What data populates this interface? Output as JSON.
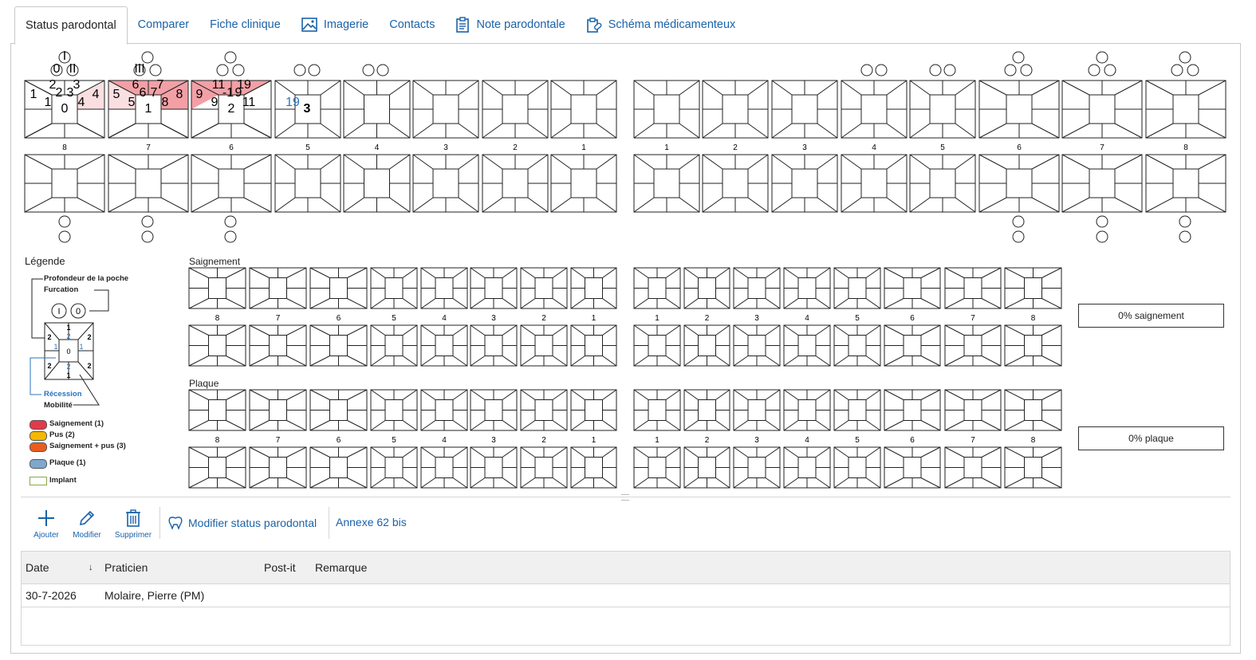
{
  "tabs": [
    {
      "label": "Status parodontal",
      "icon": "",
      "active": true
    },
    {
      "label": "Comparer",
      "icon": ""
    },
    {
      "label": "Fiche clinique",
      "icon": ""
    },
    {
      "label": "Imagerie",
      "icon": "image-icon"
    },
    {
      "label": "Contacts",
      "icon": ""
    },
    {
      "label": "Note parodontale",
      "icon": "clipboard-icon"
    },
    {
      "label": "Schéma médicamenteux",
      "icon": "medication-icon"
    }
  ],
  "chart": {
    "upper_teeth_left": [
      "8",
      "7",
      "6",
      "5",
      "4",
      "3",
      "2",
      "1"
    ],
    "upper_teeth_right": [
      "1",
      "2",
      "3",
      "4",
      "5",
      "6",
      "7",
      "8"
    ],
    "tooth8": {
      "top_l": "2",
      "top_r": "3",
      "mid_l": "1",
      "mid_r": "4",
      "blue1": "1",
      "blue2": "2",
      "blue3": "3",
      "blue4": "4",
      "center": "0",
      "furc_top": "I",
      "furc_l": "0",
      "furc_r": "II"
    },
    "tooth7": {
      "top_l": "6",
      "top_r": "7",
      "mid_l": "5",
      "mid_r": "8",
      "blue1": "5",
      "blue2": "6",
      "blue3": "7",
      "blue4": "8",
      "center": "1",
      "furc_l": "III"
    },
    "tooth6": {
      "top_l": "11",
      "top_r": "19",
      "mid_l": "9",
      "mid_r": "9",
      "blue1": "9",
      "blue2": "-1",
      "blue3": "9",
      "blue4": "11",
      "center": "2"
    },
    "tooth5": {
      "blue1": "19",
      "center": "3"
    }
  },
  "legend": {
    "title": "Légende",
    "pocket_depth": "Profondeur de la poche",
    "furcation": "Furcation",
    "recession": "Récession",
    "mobility": "Mobilité",
    "furc_l": "I",
    "furc_r": "0",
    "diagram": {
      "t1": "1",
      "t2": "2",
      "l1": "2",
      "l2": "1",
      "r1": "2",
      "r2": "1",
      "b1": "2",
      "b2": "1",
      "bl": "2",
      "br": "2",
      "center": "0"
    },
    "items": [
      {
        "label": "Saignement (1)",
        "color": "#e23a4a"
      },
      {
        "label": "Pus (2)",
        "color": "#f5b800"
      },
      {
        "label": "Saignement + pus (3)",
        "color": "#ea5d1e"
      },
      {
        "label": "Plaque (1)",
        "color": "#7ea8cc"
      },
      {
        "label": "Implant",
        "color": "#ffffff"
      }
    ]
  },
  "sections": {
    "bleeding_title": "Saignement",
    "plaque_title": "Plaque",
    "bleeding_pct": "0% saignement",
    "plaque_pct": "0% plaque"
  },
  "toolbar": {
    "add": "Ajouter",
    "edit": "Modifier",
    "delete": "Supprimer",
    "modify_status": "Modifier status parodontal",
    "annex": "Annexe 62 bis"
  },
  "table": {
    "columns": [
      "Date",
      "Praticien",
      "Post-it",
      "Remarque"
    ],
    "sort_indicator": "↓",
    "rows": [
      {
        "date": "30-7-2026",
        "practitioner": "Molaire, Pierre (PM)",
        "postit": "",
        "remark": ""
      }
    ]
  },
  "colors": {
    "accent": "#1a62a8",
    "bleeding": "#f2a0a6",
    "bleeding_light": "#fadfe1"
  }
}
